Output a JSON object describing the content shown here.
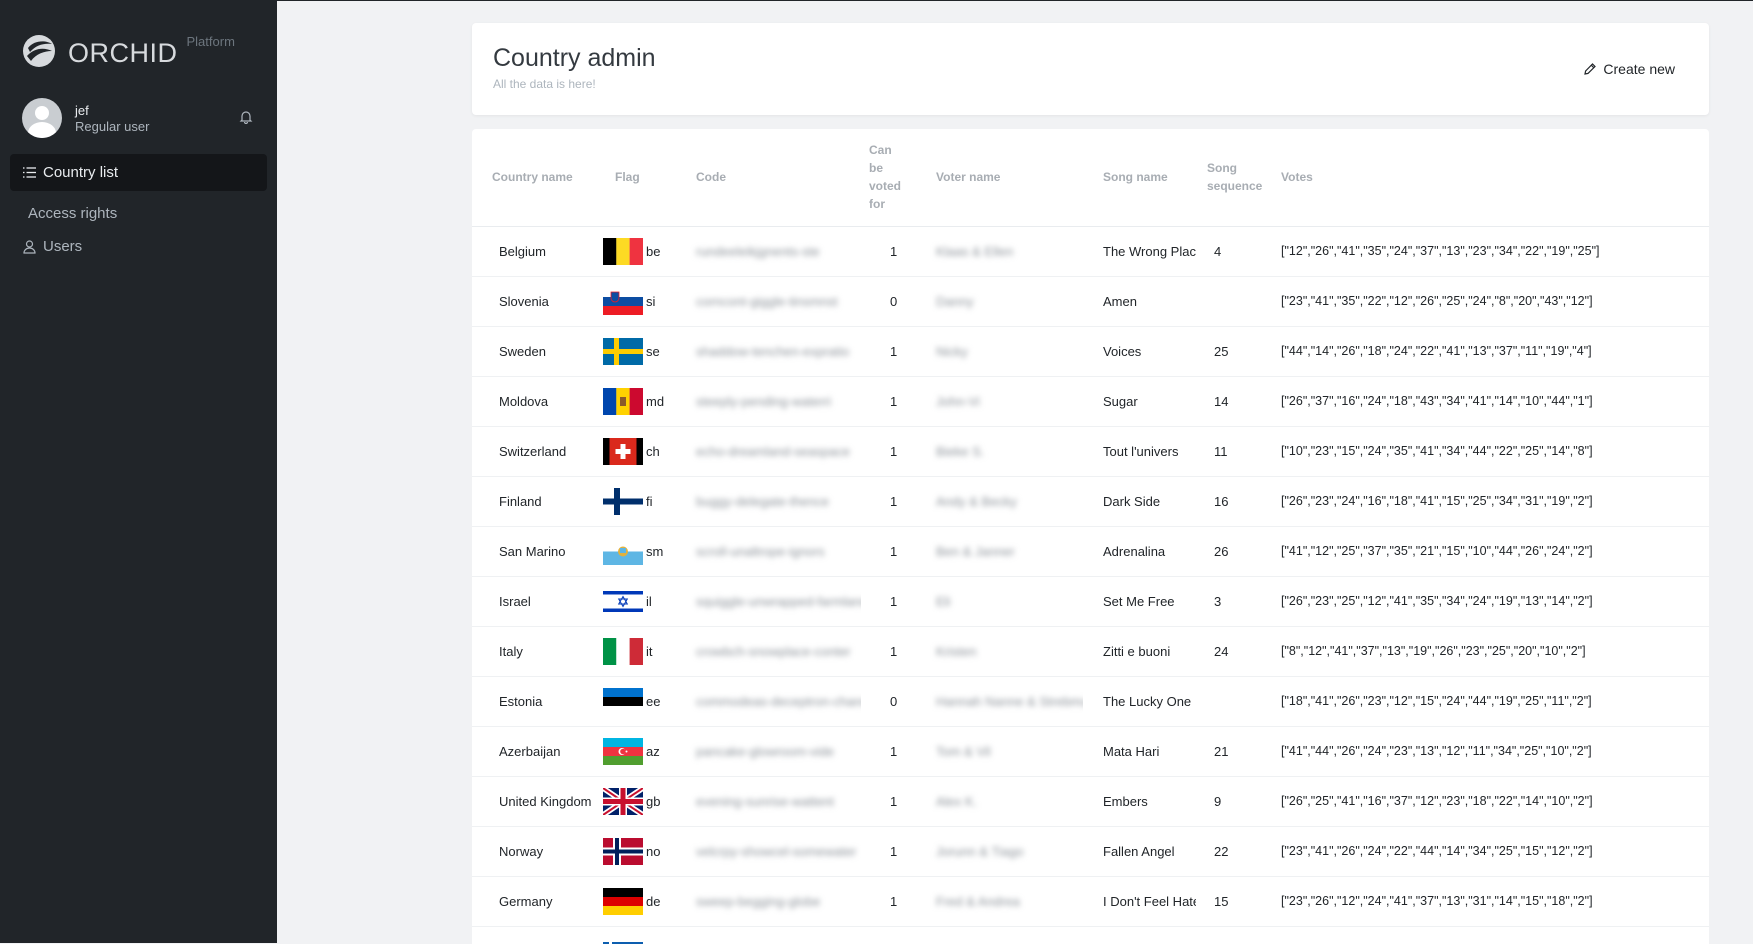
{
  "brand": {
    "name": "ORCHID",
    "sub": "Platform"
  },
  "user": {
    "name": "jef",
    "role": "Regular user"
  },
  "nav": {
    "country_list": "Country list",
    "access_rights": "Access rights",
    "users": "Users"
  },
  "header": {
    "title": "Country admin",
    "subtitle": "All the data is here!",
    "create_label": "Create new"
  },
  "columns": [
    "Country name",
    "Flag",
    "Code",
    "Can be voted for",
    "Voter name",
    "Song name",
    "Song sequence",
    "Votes"
  ],
  "rows": [
    {
      "country": "Belgium",
      "flag": "be",
      "code": "rundeeleikjgnents-ste",
      "can": "1",
      "voter": "Klaas & Ellen",
      "song": "The Wrong Place",
      "seq": "4",
      "votes": "[\"12\",\"26\",\"41\",\"35\",\"24\",\"37\",\"13\",\"23\",\"34\",\"22\",\"19\",\"25\"]"
    },
    {
      "country": "Slovenia",
      "flag": "si",
      "code": "corncont-giggle-tinsmnst",
      "can": "0",
      "voter": "Danny",
      "song": "Amen",
      "seq": "",
      "votes": "[\"23\",\"41\",\"35\",\"22\",\"12\",\"26\",\"25\",\"24\",\"8\",\"20\",\"43\",\"12\"]"
    },
    {
      "country": "Sweden",
      "flag": "se",
      "code": "shaddow-tenchen-expratio",
      "can": "1",
      "voter": "Nicky",
      "song": "Voices",
      "seq": "25",
      "votes": "[\"44\",\"14\",\"26\",\"18\",\"24\",\"22\",\"41\",\"13\",\"37\",\"11\",\"19\",\"4\"]"
    },
    {
      "country": "Moldova",
      "flag": "md",
      "code": "steeply-pending-waterri",
      "can": "1",
      "voter": "John-Vi",
      "song": "Sugar",
      "seq": "14",
      "votes": "[\"26\",\"37\",\"16\",\"24\",\"18\",\"43\",\"34\",\"41\",\"14\",\"10\",\"44\",\"1\"]"
    },
    {
      "country": "Switzerland",
      "flag": "ch",
      "code": "echo-dreamland-seaspace",
      "can": "1",
      "voter": "Bieke S.",
      "song": "Tout l'univers",
      "seq": "11",
      "votes": "[\"10\",\"23\",\"15\",\"24\",\"35\",\"41\",\"34\",\"44\",\"22\",\"25\",\"14\",\"8\"]"
    },
    {
      "country": "Finland",
      "flag": "fi",
      "code": "buggy-delegate-thence",
      "can": "1",
      "voter": "Andy & Becky",
      "song": "Dark Side",
      "seq": "16",
      "votes": "[\"26\",\"23\",\"24\",\"16\",\"18\",\"41\",\"15\",\"25\",\"34\",\"31\",\"19\",\"2\"]"
    },
    {
      "country": "San Marino",
      "flag": "sm",
      "code": "scroll-unaltrope-ignors",
      "can": "1",
      "voter": "Ben & Janner",
      "song": "Adrenalina",
      "seq": "26",
      "votes": "[\"41\",\"12\",\"25\",\"37\",\"35\",\"21\",\"15\",\"10\",\"44\",\"26\",\"24\",\"2\"]"
    },
    {
      "country": "Israel",
      "flag": "il",
      "code": "squiggle-unwrapped-farmlands",
      "can": "1",
      "voter": "Eli",
      "song": "Set Me Free",
      "seq": "3",
      "votes": "[\"26\",\"23\",\"25\",\"12\",\"41\",\"35\",\"34\",\"24\",\"19\",\"13\",\"14\",\"2\"]"
    },
    {
      "country": "Italy",
      "flag": "it",
      "code": "crowbch-snowplace-conter",
      "can": "1",
      "voter": "Kristen",
      "song": "Zitti e buoni",
      "seq": "24",
      "votes": "[\"8\",\"12\",\"41\",\"37\",\"13\",\"19\",\"26\",\"23\",\"25\",\"20\",\"10\",\"2\"]"
    },
    {
      "country": "Estonia",
      "flag": "ee",
      "code": "commodeas-deceptron-chandeler",
      "can": "0",
      "voter": "Hannah Nanne & Strebmug",
      "song": "The Lucky One",
      "seq": "",
      "votes": "[\"18\",\"41\",\"26\",\"23\",\"12\",\"15\",\"24\",\"44\",\"19\",\"25\",\"11\",\"2\"]"
    },
    {
      "country": "Azerbaijan",
      "flag": "az",
      "code": "pancake-glowroom-vide",
      "can": "1",
      "voter": "Tom & Vil",
      "song": "Mata Hari",
      "seq": "21",
      "votes": "[\"41\",\"44\",\"26\",\"24\",\"23\",\"13\",\"12\",\"11\",\"34\",\"25\",\"10\",\"2\"]"
    },
    {
      "country": "United Kingdom",
      "flag": "gb",
      "code": "evening-sunrise-wattent",
      "can": "1",
      "voter": "Alex K.",
      "song": "Embers",
      "seq": "9",
      "votes": "[\"26\",\"25\",\"41\",\"16\",\"37\",\"12\",\"23\",\"18\",\"22\",\"14\",\"10\",\"2\"]"
    },
    {
      "country": "Norway",
      "flag": "no",
      "code": "velcrpy-showcel-somewater",
      "can": "1",
      "voter": "Jorunn & Tiago",
      "song": "Fallen Angel",
      "seq": "22",
      "votes": "[\"23\",\"41\",\"26\",\"24\",\"22\",\"44\",\"14\",\"34\",\"25\",\"15\",\"12\",\"2\"]"
    },
    {
      "country": "Germany",
      "flag": "de",
      "code": "sweep-begging-globe",
      "can": "1",
      "voter": "Fred & Andrea",
      "song": "I Don't Feel Hate",
      "seq": "15",
      "votes": "[\"23\",\"26\",\"12\",\"24\",\"41\",\"37\",\"13\",\"31\",\"14\",\"15\",\"18\",\"2\"]"
    }
  ],
  "partial_row": {
    "flag": "gr"
  },
  "colors": {
    "sidebar_bg": "#212529",
    "accent_active": "#141619",
    "page_bg": "#f1f2f4"
  }
}
